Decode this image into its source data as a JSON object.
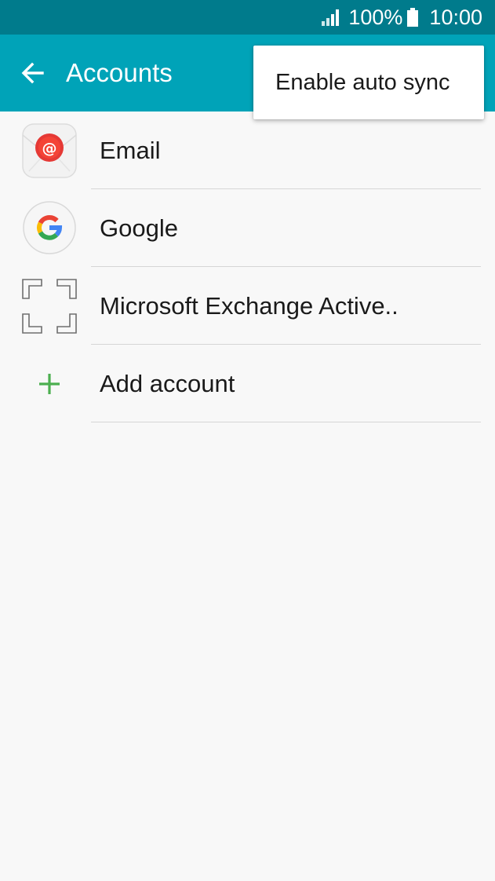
{
  "status_bar": {
    "battery_percent": "100%",
    "time": "10:00"
  },
  "app_bar": {
    "title": "Accounts"
  },
  "popup_menu": {
    "items": [
      "Enable auto sync"
    ]
  },
  "accounts": [
    {
      "label": "Email",
      "icon": "email-icon"
    },
    {
      "label": "Google",
      "icon": "google-icon"
    },
    {
      "label": "Microsoft Exchange Active..",
      "icon": "exchange-icon"
    },
    {
      "label": "Add account",
      "icon": "plus-icon"
    }
  ],
  "colors": {
    "status_bar": "#007b8c",
    "app_bar": "#00a3b8",
    "background": "#f8f8f8",
    "add_icon": "#4caf50"
  }
}
